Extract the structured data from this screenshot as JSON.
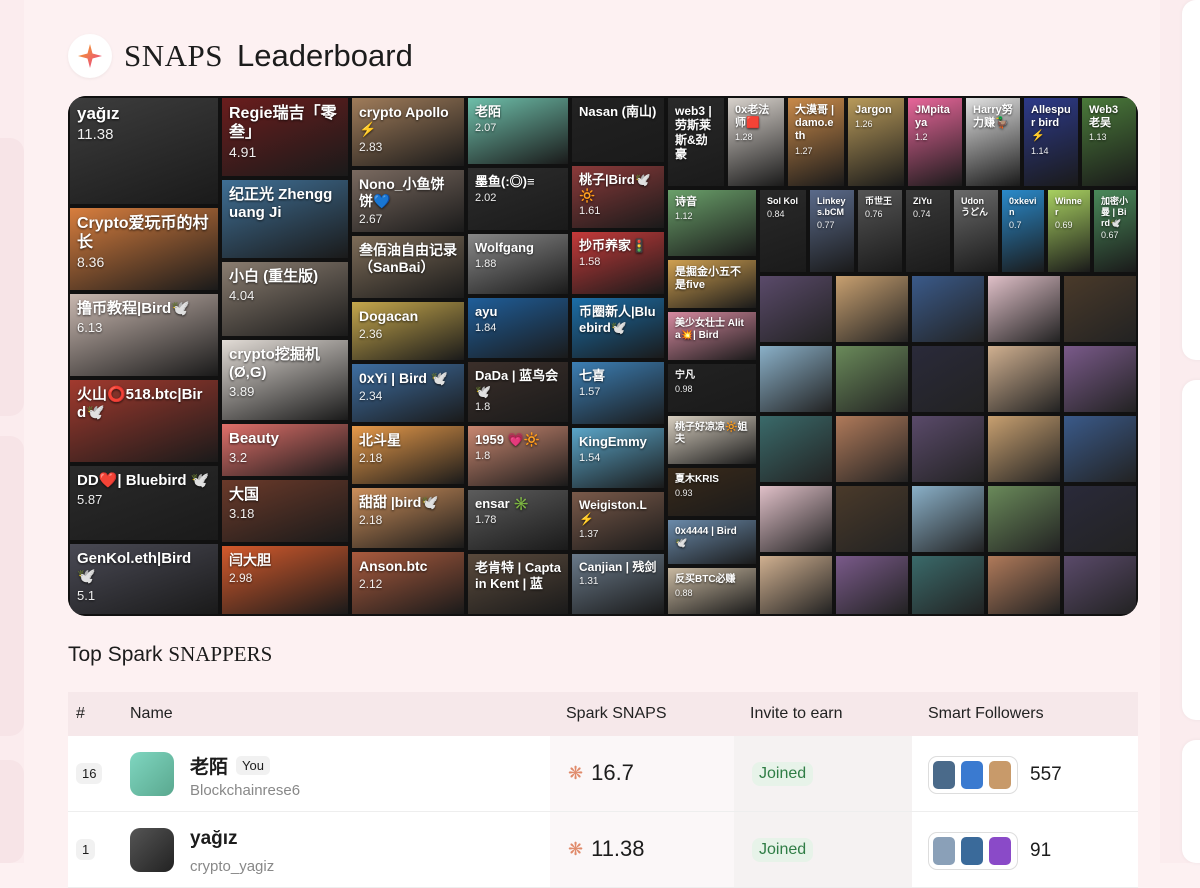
{
  "header": {
    "snaps": "SNAPS",
    "leaderboard": "Leaderboard"
  },
  "treemap": {
    "tiles": [
      {
        "n": "yağız",
        "v": "11.38",
        "c": "#3d3d3d"
      },
      {
        "n": "Crypto爱玩币的村长",
        "v": "8.36",
        "c": "#d87e3e"
      },
      {
        "n": "撸币教程|Bird🕊️",
        "v": "6.13",
        "c": "#c9b8b0"
      },
      {
        "n": "火山⭕️518.btc|Bird🕊️",
        "v": "",
        "c": "#a23a2e"
      },
      {
        "n": "DD❤️| Bluebird 🕊️",
        "v": "5.87",
        "c": "#2b2b2b"
      },
      {
        "n": "GenKol.eth|Bird 🕊️",
        "v": "5.1",
        "c": "#4a4a55"
      },
      {
        "n": "Regie瑞吉「零叁」",
        "v": "4.91",
        "c": "#6a1d1d"
      },
      {
        "n": "纪正光 Zhengguang Ji",
        "v": "",
        "c": "#3f6f95"
      },
      {
        "n": "小白 (重生版)",
        "v": "4.04",
        "c": "#8a7d70"
      },
      {
        "n": "crypto挖掘机 (Ø,G)",
        "v": "3.89",
        "c": "#e2dcd6"
      },
      {
        "n": "Beauty",
        "v": "3.2",
        "c": "#e0706a"
      },
      {
        "n": "大国",
        "v": "3.18",
        "c": "#6b3a2a"
      },
      {
        "n": "闫大胆",
        "v": "2.98",
        "c": "#d45a2c"
      },
      {
        "n": "crypto Apollo⚡",
        "v": "2.83",
        "c": "#a07c5a"
      },
      {
        "n": "Nono_小鱼饼饼💙",
        "v": "2.67",
        "c": "#7a6a60"
      },
      {
        "n": "叁佰油自由记录（SanBai）",
        "v": "",
        "c": "#7d6c58"
      },
      {
        "n": "Dogacan",
        "v": "2.36",
        "c": "#c5a74c"
      },
      {
        "n": "0xYi | Bird 🕊️",
        "v": "2.34",
        "c": "#3e6fa3"
      },
      {
        "n": "北斗星",
        "v": "2.18",
        "c": "#e79a4a"
      },
      {
        "n": "甜甜 |bird🕊️",
        "v": "2.18",
        "c": "#cc8f5b"
      },
      {
        "n": "Anson.btc",
        "v": "2.12",
        "c": "#aa5b3e"
      },
      {
        "n": "老陌",
        "v": "2.07",
        "c": "#6ebfaa"
      },
      {
        "n": "墨鱼(:◎)≡",
        "v": "2.02",
        "c": "#2d2d2d"
      },
      {
        "n": "Wolfgang",
        "v": "1.88",
        "c": "#888"
      },
      {
        "n": "ayu",
        "v": "1.84",
        "c": "#1f5e9a"
      },
      {
        "n": "DaDa | 蓝鸟会🕊️",
        "v": "1.8",
        "c": "#3b2f2a"
      },
      {
        "n": "1959 💗🔆",
        "v": "1.8",
        "c": "#c98770"
      },
      {
        "n": "ensar ✳️",
        "v": "1.78",
        "c": "#5c5c5c"
      },
      {
        "n": "老肯特 | Captain Kent | 蓝",
        "v": "",
        "c": "#5a4a3c"
      },
      {
        "n": "Nasan (南山)",
        "v": "",
        "c": "#222"
      },
      {
        "n": "桃子|Bird🕊️🔆",
        "v": "1.61",
        "c": "#8b3a3a"
      },
      {
        "n": "抄币养家🚦",
        "v": "1.58",
        "c": "#c53a3a"
      },
      {
        "n": "币圈新人|Bluebird🕊️",
        "v": "",
        "c": "#1b6ea8"
      },
      {
        "n": "七喜",
        "v": "1.57",
        "c": "#3c7fb5"
      },
      {
        "n": "KingEmmy",
        "v": "1.54",
        "c": "#5aa5c8"
      },
      {
        "n": "Weigiston.L⚡",
        "v": "1.37",
        "c": "#7a5a4a"
      },
      {
        "n": "Canjian | 残剑",
        "v": "1.31",
        "c": "#6a7a8a"
      },
      {
        "n": "web3 | 劳斯莱斯&劲豪",
        "v": "",
        "c": "#2a2a2a"
      },
      {
        "n": "0x老法师🟥",
        "v": "1.28",
        "c": "#d8d2cc"
      },
      {
        "n": "大漠哥 | damo.eth",
        "v": "1.27",
        "c": "#c98a4a"
      },
      {
        "n": "Jargon",
        "v": "1.26",
        "c": "#b89a5a"
      },
      {
        "n": "JMpitaya",
        "v": "1.2",
        "c": "#e8669a"
      },
      {
        "n": "Harry努力赚🦆",
        "v": "",
        "c": "#e1e1e1"
      },
      {
        "n": "Allespur bird⚡",
        "v": "1.14",
        "c": "#2d3a8a"
      },
      {
        "n": "Web3老吴",
        "v": "1.13",
        "c": "#4a7a3a"
      },
      {
        "n": "诗音",
        "v": "1.12",
        "c": "#6aa06a"
      },
      {
        "n": "是掘金小五不是five",
        "v": "",
        "c": "#d0a050"
      },
      {
        "n": "美少女壮士 Alita💥| Bird",
        "v": "",
        "c": "#d78aa0"
      },
      {
        "n": "宁凡",
        "v": "0.98",
        "c": "#222"
      },
      {
        "n": "桃子好凉凉🔆姐夫",
        "v": "",
        "c": "#d8cfc0"
      },
      {
        "n": "夏木KRIS",
        "v": "0.93",
        "c": "#3a2a1a"
      },
      {
        "n": "0x4444 | Bird🕊️",
        "v": "",
        "c": "#6a8aaa"
      },
      {
        "n": "反买BTC必赚",
        "v": "0.88",
        "c": "#c8b8a0"
      },
      {
        "n": "Sol Kol",
        "v": "0.84",
        "c": "#2a2a2a"
      },
      {
        "n": "Linkeys.bCM",
        "v": "0.77",
        "c": "#5a6a8a"
      },
      {
        "n": "币世王",
        "v": "0.76",
        "c": "#555"
      },
      {
        "n": "ZiYu",
        "v": "0.74",
        "c": "#3a3a3a"
      },
      {
        "n": "Udon うどん",
        "v": "",
        "c": "#6a6a6a"
      },
      {
        "n": "0xkevin",
        "v": "0.7",
        "c": "#2a8acb"
      },
      {
        "n": "Winner",
        "v": "0.69",
        "c": "#a8d060"
      },
      {
        "n": "加密小曼 | Bird🕊️",
        "v": "0.67",
        "c": "#4a8a5a"
      }
    ]
  },
  "section": {
    "prefix": "Top Spark",
    "suffix": "SNAPPERS"
  },
  "table": {
    "headers": {
      "rank": "#",
      "name": "Name",
      "snaps": "Spark SNAPS",
      "invite": "Invite to earn",
      "followers": "Smart Followers"
    },
    "rows": [
      {
        "rank": "16",
        "name": "老陌",
        "you": "You",
        "handle": "Blockchainrese6",
        "snaps": "16.7",
        "invite": "Joined",
        "followers": "557"
      },
      {
        "rank": "1",
        "name": "yağız",
        "you": "",
        "handle": "crypto_yagiz",
        "snaps": "11.38",
        "invite": "Joined",
        "followers": "91"
      }
    ]
  },
  "colors": {
    "accent_green": "#2f7d45",
    "page_bg": "#fdf1f2"
  }
}
